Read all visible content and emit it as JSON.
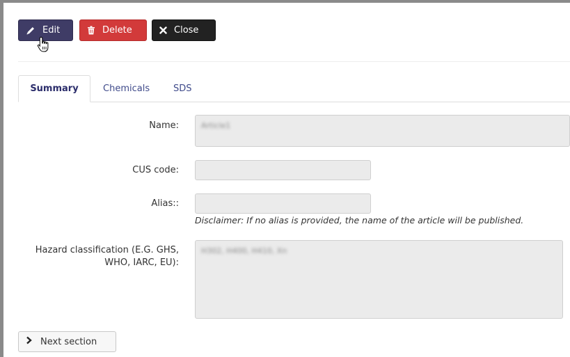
{
  "toolbar": {
    "edit_label": "Edit",
    "delete_label": "Delete",
    "close_label": "Close",
    "edit_icon": "pencil-icon",
    "delete_icon": "trash-icon",
    "close_icon": "x-icon",
    "colors": {
      "edit": "#3f3c66",
      "delete": "#d23a3a",
      "close": "#222222"
    }
  },
  "tabs": [
    {
      "label": "Summary",
      "active": true
    },
    {
      "label": "Chemicals",
      "active": false
    },
    {
      "label": "SDS",
      "active": false
    }
  ],
  "form": {
    "name": {
      "label": "Name:",
      "value": "Article1"
    },
    "cus_code": {
      "label": "CUS code:",
      "value": ""
    },
    "alias": {
      "label": "Alias::",
      "value": ""
    },
    "disclaimer": "Disclaimer: If no alias is provided, the name of the article will be published.",
    "hazard": {
      "label_line1": "Hazard classification (E.G. GHS,",
      "label_line2": "WHO, IARC, EU):",
      "value": "H302, H400, H410, Xn"
    }
  },
  "footer": {
    "next_label": "Next section",
    "next_icon": "chevron-right-icon"
  }
}
